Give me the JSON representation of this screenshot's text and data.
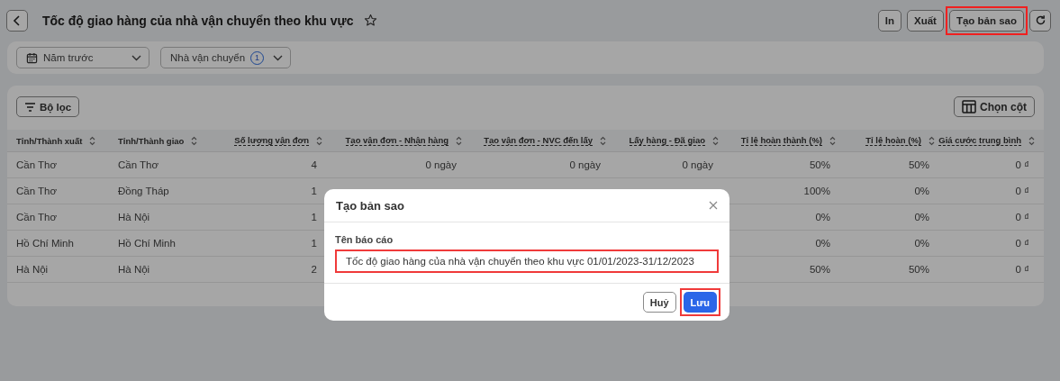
{
  "header": {
    "title": "Tốc độ giao hàng của nhà vận chuyển theo khu vực",
    "starred": false,
    "actions": [
      {
        "label": "In",
        "highlighted": false
      },
      {
        "label": "Xuất",
        "highlighted": false
      },
      {
        "label": "Tạo bản sao",
        "highlighted": true
      }
    ]
  },
  "filters": [
    {
      "kind": "date",
      "label": "Năm trước"
    },
    {
      "kind": "count",
      "label": "Nhà vận chuyển",
      "count": "1"
    }
  ],
  "toolbar": {
    "filter_button": "Bộ lọc",
    "columns_button": "Chọn cột"
  },
  "table": {
    "columns": [
      {
        "label": "Tỉnh/Thành xuất",
        "has_hint": false
      },
      {
        "label": "Tỉnh/Thành giao",
        "has_hint": false
      },
      {
        "label": "Số lượng vận đơn",
        "has_hint": true
      },
      {
        "label": "Tạo vận đơn - Nhận hàng",
        "has_hint": true
      },
      {
        "label": "Tạo vận đơn - NVC đến lấy",
        "has_hint": true
      },
      {
        "label": "Lấy hàng - Đã giao",
        "has_hint": true
      },
      {
        "label": "Tỉ lệ hoàn thành (%)",
        "has_hint": true
      },
      {
        "label": "Tỉ lệ hoàn (%)",
        "has_hint": true
      },
      {
        "label": "Giá cước trung bình",
        "has_hint": true
      }
    ],
    "rows": [
      {
        "cells": [
          "Cần Thơ",
          "Cần Thơ",
          "4",
          "0 ngày",
          "0 ngày",
          "0 ngày",
          "50%",
          "50%",
          "0 ₫"
        ]
      },
      {
        "cells": [
          "Cần Thơ",
          "Đồng Tháp",
          "1",
          null,
          null,
          null,
          "100%",
          "0%",
          "0 ₫"
        ]
      },
      {
        "cells": [
          "Cần Thơ",
          "Hà Nội",
          "1",
          null,
          null,
          null,
          "0%",
          "0%",
          "0 ₫"
        ]
      },
      {
        "cells": [
          "Hồ Chí Minh",
          "Hồ Chí Minh",
          "1",
          null,
          null,
          null,
          "0%",
          "0%",
          "0 ₫"
        ]
      },
      {
        "cells": [
          "Hà Nội",
          "Hà Nội",
          "2",
          null,
          null,
          null,
          "50%",
          "50%",
          "0 ₫"
        ]
      }
    ]
  },
  "dialog": {
    "title": "Tạo bản sao",
    "field_label": "Tên báo cáo",
    "field_value": "Tốc độ giao hàng của nhà vận chuyển theo khu vực 01/01/2023-31/12/2023",
    "field_highlighted": true,
    "cancel": "Huỷ",
    "save": "Lưu",
    "save_highlighted": true
  }
}
